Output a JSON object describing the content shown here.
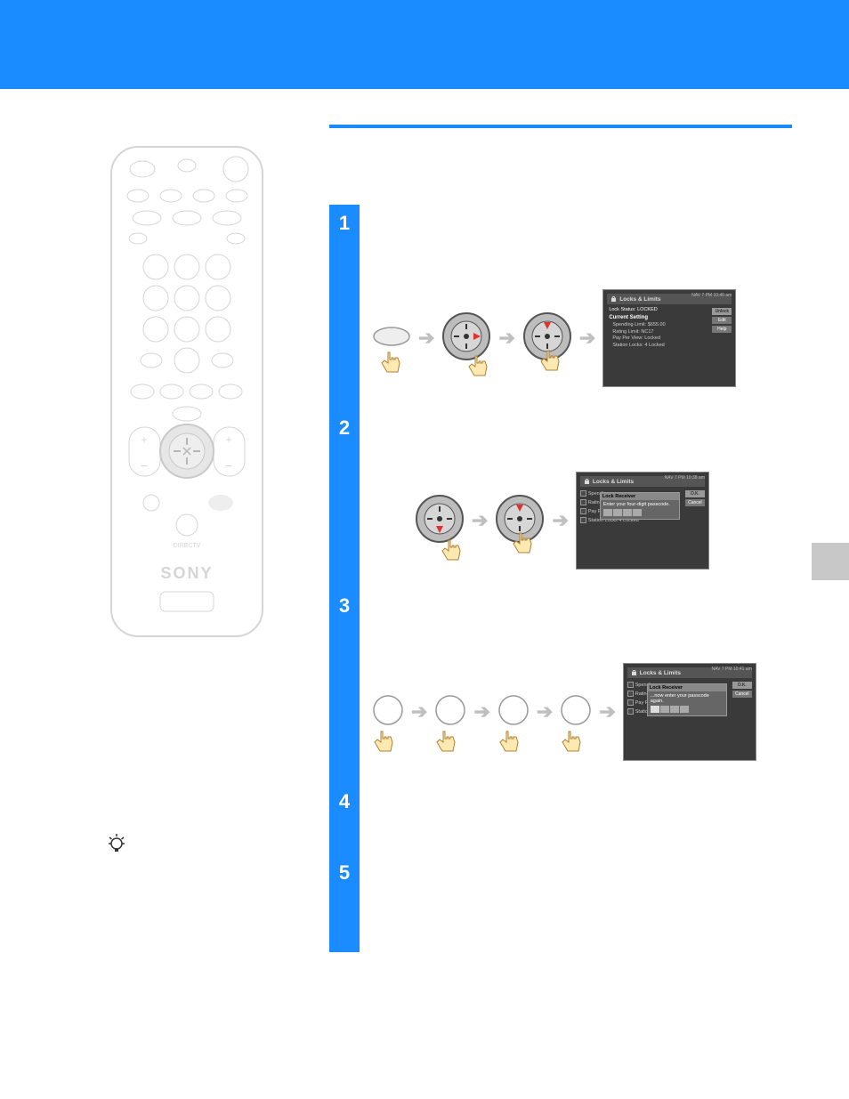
{
  "brand": "SONY",
  "brand_sub": "DIRECTV",
  "tip_label": "tip",
  "steps": [
    {
      "num": "1"
    },
    {
      "num": "2"
    },
    {
      "num": "3"
    },
    {
      "num": "4"
    },
    {
      "num": "5"
    }
  ],
  "tv1": {
    "title": "Locks & Limits",
    "stamp": "NAV 7 PM 10:40 am",
    "lock_status_row": "Lock Status:  LOCKED",
    "section": "Current Setting",
    "rows": [
      "Spending Limit:  $655.00",
      "Rating Limit:  NC17",
      "Pay Per View:  Locked",
      "Station Locks:  4 Locked"
    ],
    "btns": [
      "Unlock",
      "Edit",
      "Help"
    ]
  },
  "tv2": {
    "title": "Locks & Limits",
    "stamp": "NAV 7 PM 10:38 am",
    "left_items": [
      "Spending",
      "Rating",
      "Pay Per",
      "Station Locks  4 Locked"
    ],
    "popup_title": "Lock Receiver",
    "popup_text": "Enter your four-digit passcode.",
    "popup_btns": [
      "O.K.",
      "Cancel"
    ]
  },
  "tv3": {
    "title": "Locks & Limits",
    "stamp": "NAV 7 PM 10:41 am",
    "left_items": [
      "Spending",
      "Rating",
      "Pay Per",
      "Station Locks  4 Locked"
    ],
    "popup_title": "Lock Receiver",
    "popup_text": "...now enter your passcode again.",
    "popup_btns": [
      "O.K.",
      "Cancel"
    ]
  }
}
